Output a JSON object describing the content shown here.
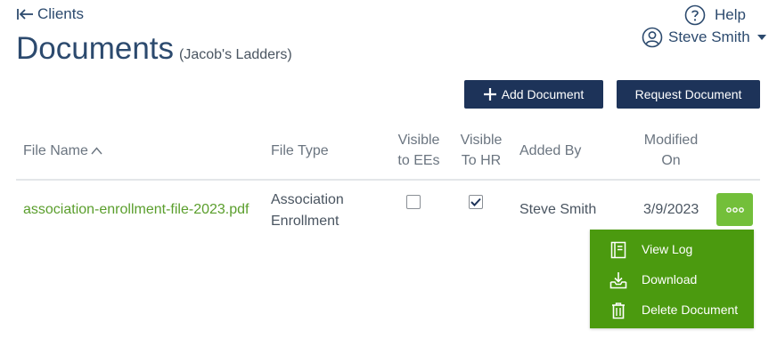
{
  "nav": {
    "back_label": "Clients"
  },
  "header": {
    "title": "Documents",
    "subtitle": "(Jacob's Ladders)",
    "help_label": "Help",
    "user_name": "Steve Smith"
  },
  "actions": {
    "add_label": "Add Document",
    "request_label": "Request Document"
  },
  "table": {
    "columns": {
      "file_name": "File Name",
      "file_type": "File Type",
      "visible_ees_1": "Visible",
      "visible_ees_2": "to EEs",
      "visible_hr_1": "Visible",
      "visible_hr_2": "To HR",
      "added_by": "Added By",
      "modified_1": "Modified",
      "modified_2": "On"
    },
    "rows": [
      {
        "file_name": "association-enrollment-file-2023.pdf",
        "file_type_1": "Association",
        "file_type_2": "Enrollment",
        "visible_to_ees": false,
        "visible_to_hr": true,
        "added_by": "Steve Smith",
        "modified_on": "3/9/2023"
      }
    ]
  },
  "row_menu": {
    "items": [
      {
        "label": "View Log",
        "icon": "log-book-icon"
      },
      {
        "label": "Download",
        "icon": "download-tray-icon"
      },
      {
        "label": "Delete Document",
        "icon": "trash-icon"
      }
    ]
  },
  "colors": {
    "navy": "#1d3359",
    "title_blue": "#2c4a6e",
    "link_green": "#5a9e2c",
    "menu_green": "#4b9a0f",
    "more_button_green": "#73bf3a"
  }
}
